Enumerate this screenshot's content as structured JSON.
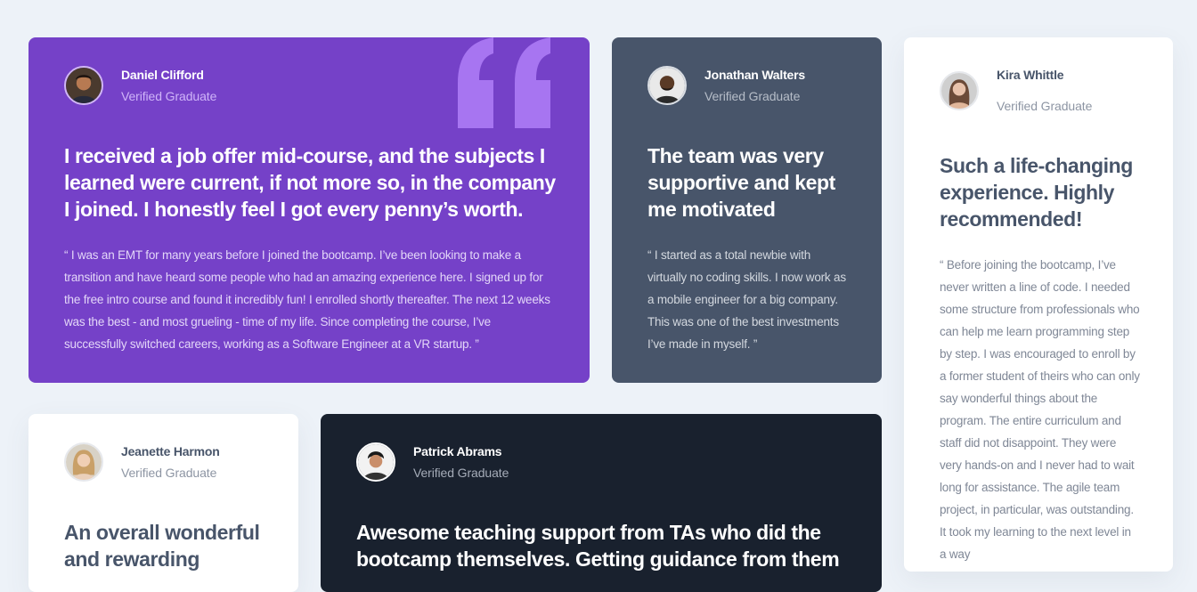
{
  "colors": {
    "page_background": "#edf2f8",
    "moderate_violet": "#7541c8",
    "grayish_blue": "#48556a",
    "very_dark_blackish_blue": "#19212e",
    "white": "#ffffff",
    "quote_mark": "#a775f1"
  },
  "testimonials": [
    {
      "name": "Daniel Clifford",
      "role": "Verified Graduate",
      "headline": "I received a job offer mid-course, and the subjects I learned were current, if not more so, in the company I joined. I honestly feel I got every penny’s worth.",
      "body": "“ I was an EMT for many years before I joined the bootcamp. I’ve been looking to make a transition and have heard some people who had an amazing experience here. I signed up for the free intro course and found it incredibly fun! I enrolled shortly thereafter. The next 12 weeks was the best - and most grueling - time of my life. Since completing the course, I’ve successfully switched careers, working as a Software Engineer at a VR startup. ”",
      "icon": "quotation-mark-icon"
    },
    {
      "name": "Jonathan Walters",
      "role": "Verified Graduate",
      "headline": "The team was very supportive and kept me motivated",
      "body": "“ I started as a total newbie with virtually no coding skills. I now work as a mobile engineer for a big company. This was one of the best investments I’ve made in myself. ”"
    },
    {
      "name": "Kira Whittle",
      "role": "Verified Graduate",
      "headline": "Such a life-changing experience. Highly recommended!",
      "body": "“ Before joining the bootcamp, I’ve never written a line of code. I needed some structure from professionals who can help me learn programming step by step. I was encouraged to enroll by a former student of theirs who can only say wonderful things about the program. The entire curriculum and staff did not disappoint. They were very hands-on and I never had to wait long for assistance. The agile team project, in particular, was outstanding. It took my learning to the next level in a way"
    },
    {
      "name": "Jeanette Harmon",
      "role": "Verified Graduate",
      "headline": "An overall wonderful and rewarding"
    },
    {
      "name": "Patrick Abrams",
      "role": "Verified Graduate",
      "headline": "Awesome teaching support from TAs who did the bootcamp themselves. Getting guidance from them"
    }
  ]
}
